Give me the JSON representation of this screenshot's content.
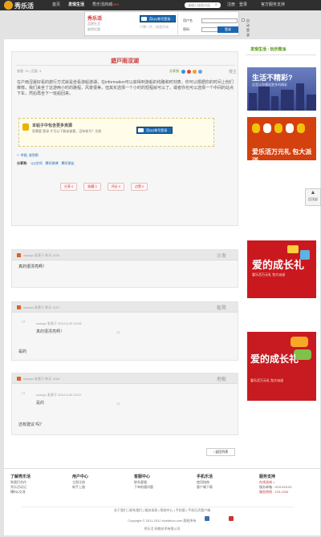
{
  "topnav": {
    "logo": "秀乐活",
    "items": [
      "首页",
      "发现生活",
      "秀乐活商城"
    ],
    "hot": "NEW",
    "search_placeholder": "请输入搜索内容",
    "register": "注册",
    "login": "登录",
    "service": "官方服务支持"
  },
  "loginbar": {
    "logo": "秀乐活",
    "tag1": "品牌生活",
    "tag2": "取得优惠",
    "qq_label": "用QQ帐号登录",
    "qq_hint": "只需一步，快速开始",
    "user_label": "用户名",
    "pass_label": "密码",
    "auto_label": "自动登录",
    "login_btn": "登录"
  },
  "breadcrumb": {
    "a": "发现生活",
    "arrow": "›",
    "b": "玩乐帮派"
  },
  "post": {
    "title": "遊戸雨涩湖",
    "meta": "查看: 32 | 回复: 3",
    "share_label": "分享到:",
    "floor": "楼主",
    "body": "在户雨涩最好看的旅行方式就是坐看游船游湖，在information可以获得到游船的线路和时刻表，你可以根据你的时间上他们推荐。我们来坐了这游两小时的路程，风景很美，但其实选择一个小时的短程就可以了。或者你也可以选择一个中间的站点下车，然后再坐下一班船回来。",
    "hidden_title": "本帖子中包含更多资源",
    "hidden_text": "您需要 登录 才可以下载或查看，没有帐号？注册",
    "hidden_qq": "用QQ帐号登录",
    "report": "⚐ 举报, 收到帮",
    "share_to": "分享到:",
    "share_qzone": "QQ空间",
    "share_weibo": "腾讯微博",
    "share_friend": "腾讯朋友",
    "actions": [
      "分享 0",
      "收藏 0",
      "评论 0",
      "点赞 0"
    ]
  },
  "replies": [
    {
      "meta": "xuanyo 发表于 昨天 1025",
      "floor": "沙发",
      "text": "真的很漂亮啊！"
    },
    {
      "meta": "xuanyo 发表于 昨天 1237",
      "floor": "板凳",
      "quote_meta": "xuanyo 发表于 2012-6-29 22:28",
      "quote_text": "真的很漂亮啊！",
      "text": "是的"
    },
    {
      "meta": "xuanyo 发表于 昨天 1034",
      "floor": "地板",
      "quote_meta": "xuanyo 发表于 2012-6-29 22:37",
      "quote_text": "是的",
      "text": "还有建议 吗？"
    }
  ],
  "back_to_list": "‹ 返回列表",
  "ads": {
    "ad1_title": "生活不精彩?",
    "ad1_sub": "这里让你邂逅更多的精彩",
    "ad2_title": "爱乐活万元礼 包大派送",
    "ad3_title": "爱的成长礼",
    "ad3_sub": "爱乐活万元礼 包大派送",
    "ad4_title": "爱的成长礼",
    "ad4_sub": "爱乐活万元礼 包大派送"
  },
  "backtop": "回顶部",
  "footer": {
    "cols": [
      {
        "title": "了解秀乐活",
        "items": [
          "和我们合作",
          "秀乐活动记",
          "爆料&交流"
        ]
      },
      {
        "title": "用户中心",
        "items": [
          "立即注册",
          "新手上路"
        ]
      },
      {
        "title": "客服中心",
        "items": [
          "联系客服",
          "下单前遇问题"
        ]
      },
      {
        "title": "手机乐活",
        "items": [
          "使用指南",
          "客户端下载"
        ]
      },
      {
        "title": "服务支持",
        "items": [
          "在线咨询 ×",
          "服务邮箱 : XXXXXXXX",
          "服务热线 : 123-1234"
        ]
      }
    ],
    "links": "关于我们 | 联系我们 | 服务条款 | 帮助中心 | 手机版 | 手机乐活客户端",
    "copyright": "Copyright © 2011-2012 xiuelehuo.com 版权所有",
    "company": "秀乐活 网络技术有限公司"
  }
}
